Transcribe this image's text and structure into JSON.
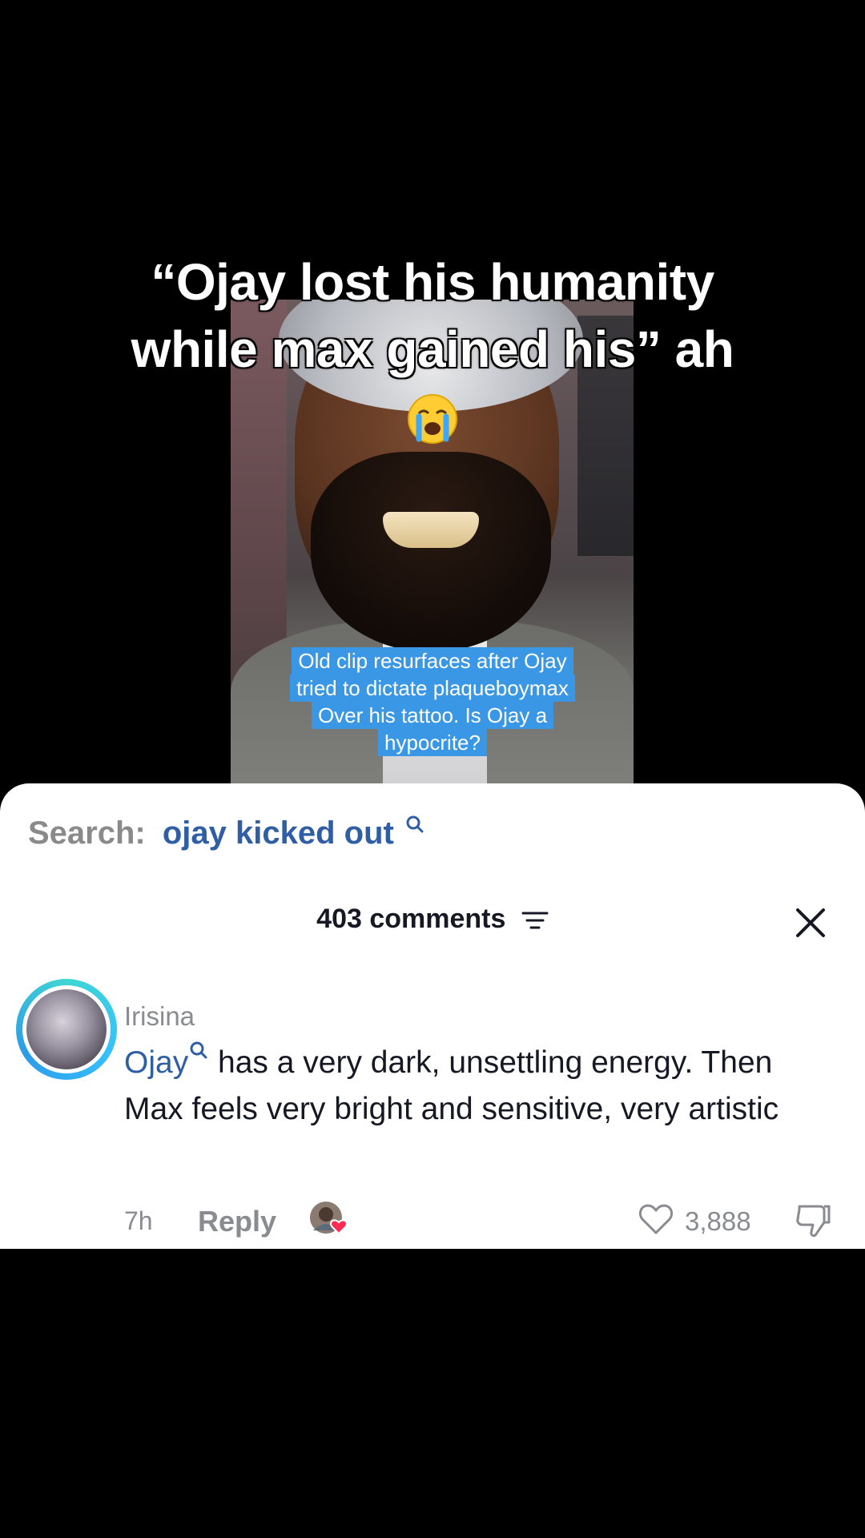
{
  "video": {
    "overlay_line1": "“Ojay lost his humanity",
    "overlay_line2": "while max gained his” ah",
    "emoji": "loudly-crying-face-emoji",
    "caption_lines": [
      "Old clip resurfaces after Ojay",
      "tried to dictate plaqueboymax",
      "Over his tattoo. Is Ojay a",
      "hypocrite?"
    ]
  },
  "sheet": {
    "search_prefix": "Search:",
    "search_term": "ojay kicked out",
    "comments_count": "403 comments",
    "close_icon": "close-icon",
    "filter_icon": "filter-icon"
  },
  "comment": {
    "username": "Irisina",
    "mention": "Ojay",
    "text": " has a very dark, unsettling energy. Then Max feels very bright and sensitive, very artistic",
    "time": "7h",
    "reply_label": "Reply",
    "like_count": "3,888"
  },
  "colors": {
    "accent_blue": "#2f5ea6",
    "caption_blue": "#3a97e6",
    "avatar_ring": "#35c0ff",
    "heart_pink": "#fe2c55",
    "muted_text": "#8a8b91"
  }
}
